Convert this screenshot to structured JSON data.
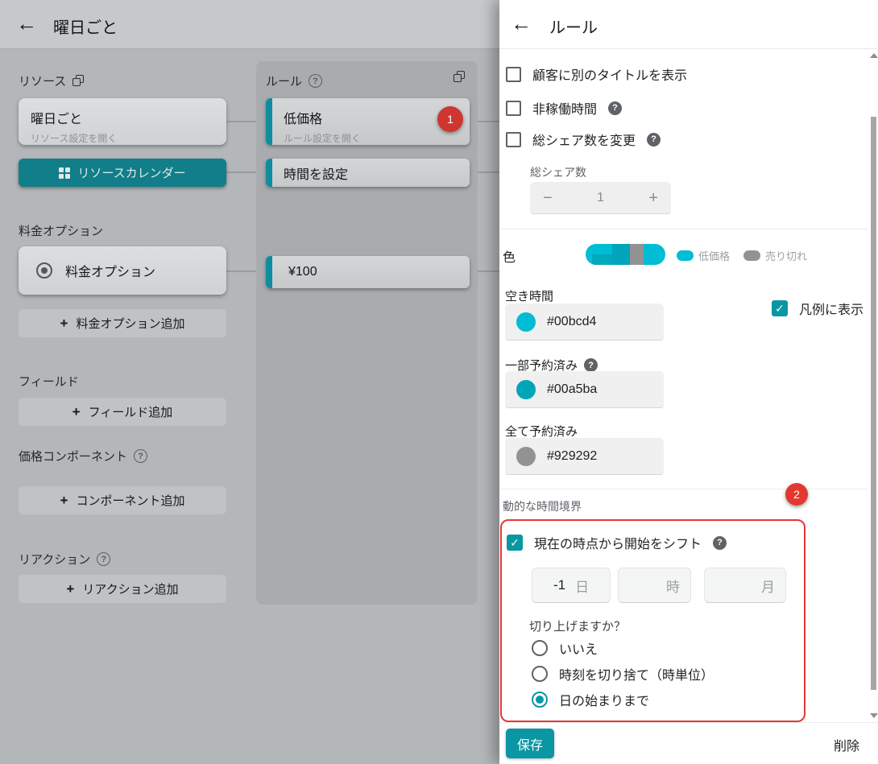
{
  "colors": {
    "accent_teal": "#0a96a2",
    "danger_red": "#e53935",
    "available": "#00bcd4",
    "partially_booked": "#00a5ba",
    "fully_booked": "#929292"
  },
  "left": {
    "header": {
      "back_icon": "←",
      "title": "曜日ごと"
    },
    "resources": {
      "label": "リソース",
      "card": {
        "title": "曜日ごと",
        "subtitle": "リソース設定を開く"
      },
      "calendar_button": "リソースカレンダー"
    },
    "price_options": {
      "label": "料金オプション",
      "card_title": "料金オプション",
      "add_button": "料金オプション追加"
    },
    "fields": {
      "label": "フィールド",
      "add_button": "フィールド追加"
    },
    "price_components": {
      "label": "価格コンポーネント",
      "add_button": "コンポーネント追加",
      "help": "?"
    },
    "reactions": {
      "label": "リアクション",
      "add_button": "リアクション追加",
      "help": "?"
    },
    "rules": {
      "label": "ルール",
      "help": "?",
      "badge": "1",
      "cards": [
        {
          "title": "低価格",
          "subtitle": "ルール設定を開く"
        },
        {
          "title": "時間を設定"
        },
        {
          "title": "¥100"
        }
      ]
    },
    "plus_icon": "+"
  },
  "drawer": {
    "header": {
      "back_icon": "←",
      "title": "ルール"
    },
    "checkboxes": [
      {
        "label": "顧客に別のタイトルを表示"
      },
      {
        "label": "非稼働時間",
        "help": "?"
      },
      {
        "label": "総シェア数を変更",
        "help": "?"
      }
    ],
    "share_count": {
      "label": "総シェア数",
      "value": "1",
      "minus": "−",
      "plus": "+"
    },
    "color_section": {
      "label": "色",
      "legend": [
        {
          "label": "低価格"
        },
        {
          "label": "売り切れ"
        }
      ]
    },
    "legend_checkbox": "凡例に表示",
    "swatches": [
      {
        "label": "空き時間",
        "value": "#00bcd4"
      },
      {
        "label": "一部予約済み",
        "value": "#00a5ba",
        "help": "?"
      },
      {
        "label": "全て予約済み",
        "value": "#929292"
      }
    ],
    "dynamic": {
      "label": "動的な時間境界",
      "badge": "2",
      "shift_label": "現在の時点から開始をシフト",
      "help": "?",
      "inputs": [
        {
          "value": "-1",
          "unit": "日"
        },
        {
          "value": "",
          "unit": "時"
        },
        {
          "value": "",
          "unit": "月"
        }
      ],
      "round_label": "切り上げますか？",
      "options": [
        {
          "label": "いいえ"
        },
        {
          "label": "時刻を切り捨て（時単位）"
        },
        {
          "label": "日の始まりまで"
        }
      ]
    },
    "footer": {
      "save": "保存",
      "delete": "削除"
    }
  }
}
